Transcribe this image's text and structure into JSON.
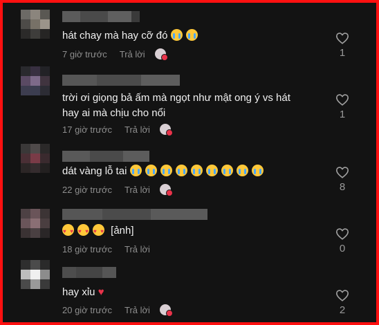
{
  "reply_label": "Trả lời",
  "comments": [
    {
      "text": "hát chay mà hay cỡ đó",
      "emojis": [
        "loudly-crying",
        "loudly-crying"
      ],
      "time": "7 giờ trước",
      "likes": "1"
    },
    {
      "text_line1": "trời ơi giọng bả ấm mà ngọt như mật ong ý vs hát",
      "text_line2": "hay ai mà chịu cho nổi",
      "time": "17 giờ trước",
      "likes": "1"
    },
    {
      "text": "dát vàng lỗ tai",
      "emojis": [
        "loudly-crying",
        "loudly-crying",
        "loudly-crying",
        "loudly-crying",
        "loudly-crying",
        "loudly-crying",
        "loudly-crying",
        "loudly-crying",
        "loudly-crying"
      ],
      "time": "22 giờ trước",
      "likes": "8"
    },
    {
      "emojis": [
        "smiling-face-with-hearts",
        "smiling-face-with-hearts",
        "smiling-face-with-hearts"
      ],
      "text": "[ảnh]",
      "time": "18 giờ trước",
      "likes": "0"
    },
    {
      "text": "hay xỉu",
      "emojis": [
        "red-heart"
      ],
      "time": "20 giờ trước",
      "likes": "2"
    }
  ],
  "colors": {
    "background": "#131313",
    "border": "#ff1010",
    "text": "#f1f1f1",
    "muted": "#8e8e8e"
  }
}
